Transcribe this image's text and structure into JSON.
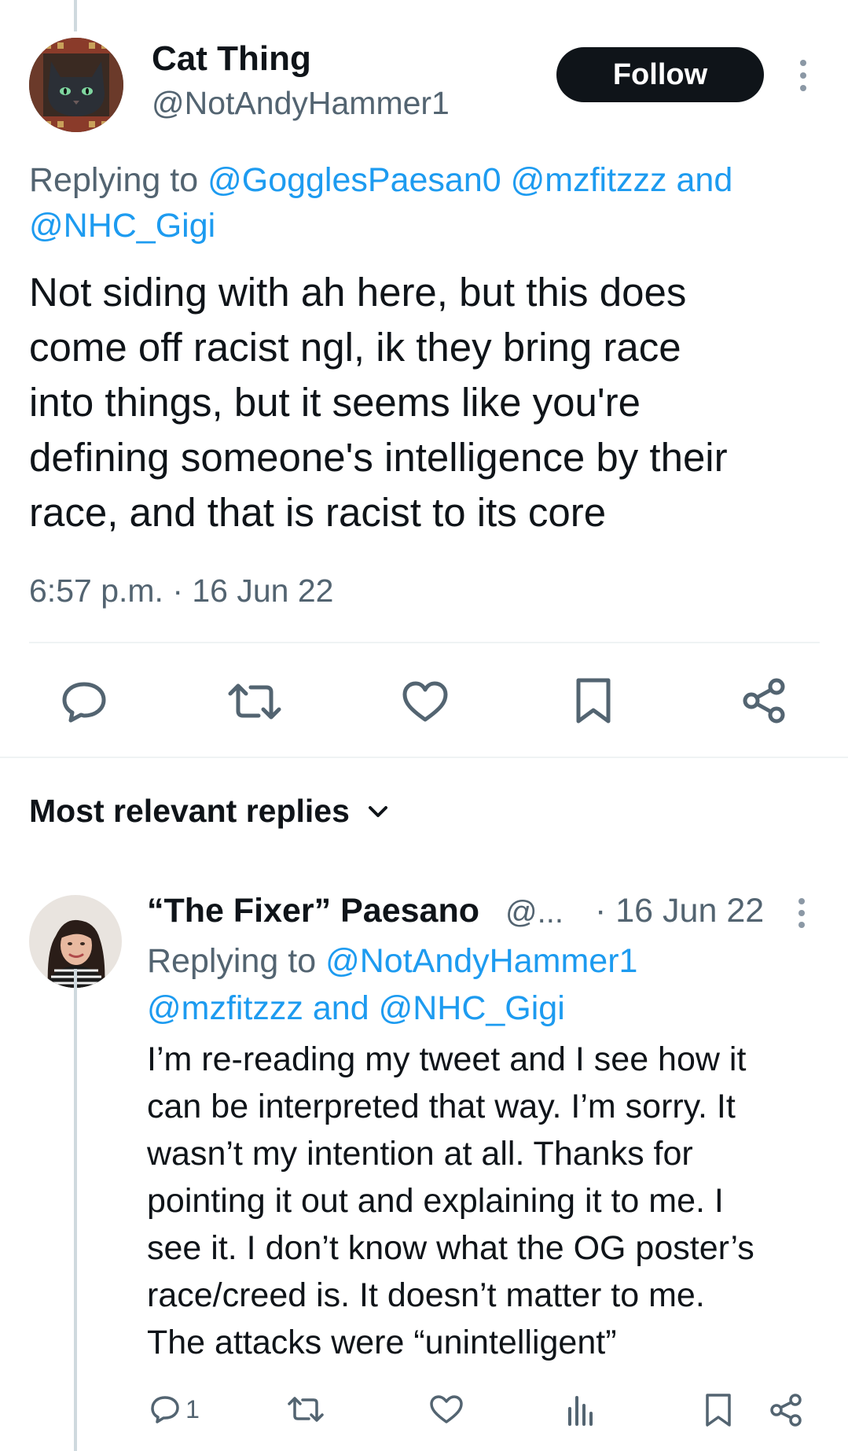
{
  "tweet": {
    "author": {
      "display_name": "Cat Thing",
      "handle": "@NotAndyHammer1"
    },
    "follow_label": "Follow",
    "replying_prefix": "Replying to",
    "replying_to": [
      "@GogglesPaesan0",
      "@mzfitzzz"
    ],
    "replying_and": "and",
    "replying_last": "@NHC_Gigi",
    "text": "Not siding with ah here, but this does\ncome off racist ngl, ik they bring race\ninto things, but it seems like you're\ndefining someone's intelligence by their\nrace, and that is racist to its core",
    "timestamp": "6:57 p.m. · 16 Jun 22",
    "actions": [
      "reply-icon",
      "retweet-icon",
      "like-icon",
      "bookmark-icon",
      "share-icon"
    ]
  },
  "replies_section": {
    "title": "Most relevant replies"
  },
  "reply": {
    "display_name": "“The Fixer” Paesano",
    "handle": "@...",
    "date": "· 16 Jun 22",
    "replying_prefix": "Replying to",
    "replying_first": "@NotAndyHammer1",
    "replying_second": "@mzfitzzz",
    "replying_and": "and",
    "replying_last": "@NHC_Gigi",
    "text": "I’m re-reading my tweet and I see how it\ncan be interpreted that way. I’m sorry. It\nwasn’t my intention at all. Thanks for\npointing it out and explaining it to me. I\nsee it. I don’t know what the OG poster’s\nrace/creed is. It doesn’t matter to me.\nThe attacks were “unintelligent”",
    "reply_count": "1"
  },
  "colors": {
    "text_primary": "#0f1419",
    "text_secondary": "#536471",
    "link": "#1d9bf0",
    "divider": "#eff3f4"
  }
}
